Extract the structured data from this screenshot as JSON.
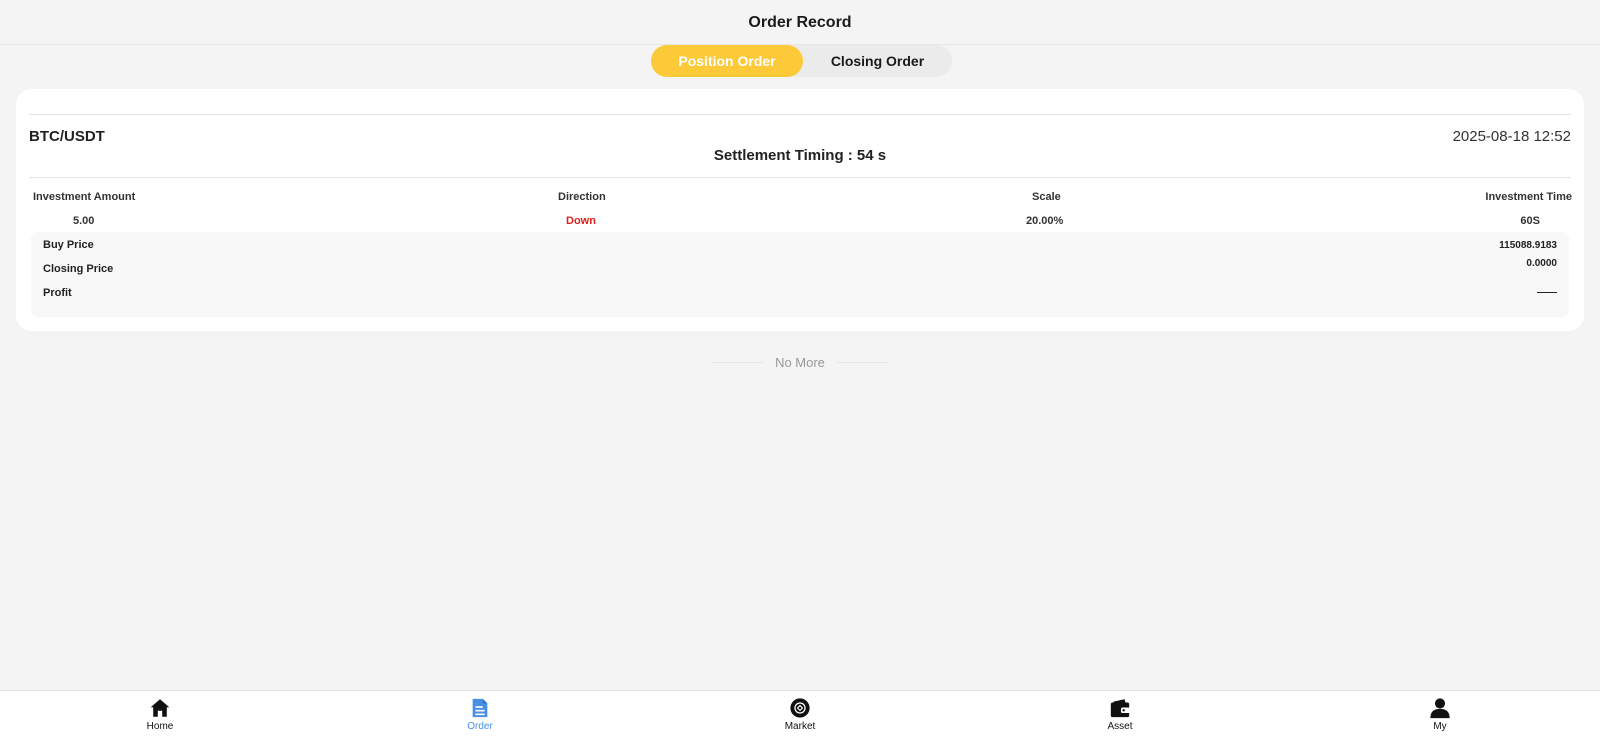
{
  "header": {
    "title": "Order Record"
  },
  "tabs": [
    {
      "label": "Position Order",
      "active": true
    },
    {
      "label": "Closing Order",
      "active": false
    }
  ],
  "order": {
    "pair": "BTC/USDT",
    "datetime": "2025-08-18 12:52",
    "settlement": "Settlement Timing : 54 s",
    "columns": [
      {
        "header": "Investment Amount",
        "value": "5.00"
      },
      {
        "header": "Direction",
        "value": "Down"
      },
      {
        "header": "Scale",
        "value": "20.00%"
      },
      {
        "header": "Investment Time",
        "value": "60S"
      }
    ],
    "prices": [
      {
        "label": "Buy Price",
        "value": "115088.9183"
      },
      {
        "label": "Closing Price",
        "value": "0.0000"
      },
      {
        "label": "Profit",
        "value": "——"
      }
    ]
  },
  "footer_note": "No More",
  "nav": {
    "active_color": "#4a90e2",
    "items": [
      {
        "label": "Home",
        "icon": "home-icon"
      },
      {
        "label": "Order",
        "icon": "order-icon",
        "active": true
      },
      {
        "label": "Market",
        "icon": "market-icon"
      },
      {
        "label": "Asset",
        "icon": "wallet-icon"
      },
      {
        "label": "My",
        "icon": "user-icon"
      }
    ]
  },
  "colors": {
    "accent": "#fcc938",
    "down": "#e02020"
  }
}
